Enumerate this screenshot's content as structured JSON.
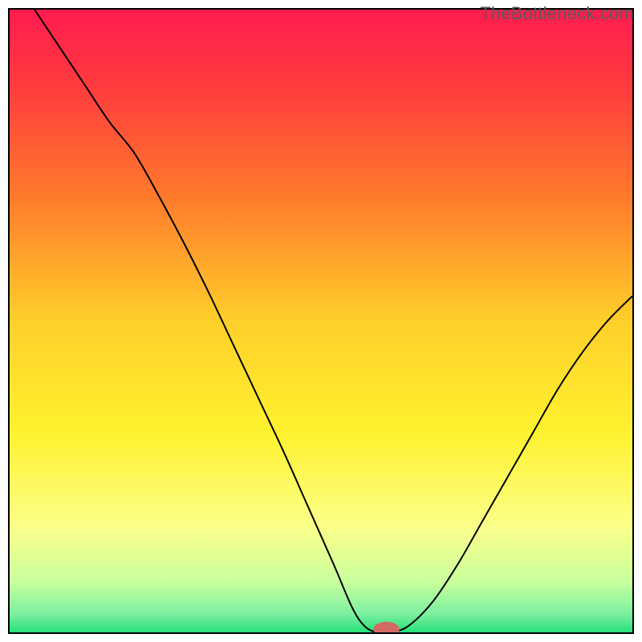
{
  "watermark": "TheBottleneck.com",
  "chart_data": {
    "type": "line",
    "title": "",
    "xlabel": "",
    "ylabel": "",
    "xlim": [
      0,
      100
    ],
    "ylim": [
      0,
      100
    ],
    "grid": false,
    "legend": false,
    "gradient_stops": [
      {
        "offset": 0.0,
        "color": "#ff1c4f"
      },
      {
        "offset": 0.12,
        "color": "#ff3a3f"
      },
      {
        "offset": 0.3,
        "color": "#ff7a2c"
      },
      {
        "offset": 0.5,
        "color": "#ffcf2a"
      },
      {
        "offset": 0.68,
        "color": "#fff22f"
      },
      {
        "offset": 0.83,
        "color": "#fbff89"
      },
      {
        "offset": 0.92,
        "color": "#c8ff9d"
      },
      {
        "offset": 0.97,
        "color": "#7cf0a0"
      },
      {
        "offset": 1.0,
        "color": "#26e07a"
      }
    ],
    "series": [
      {
        "name": "bottleneck-curve",
        "color": "#000000",
        "x": [
          4,
          8,
          12,
          16,
          20,
          24,
          28,
          32,
          36,
          40,
          44,
          48,
          52,
          55,
          57,
          59,
          61,
          64,
          68,
          72,
          76,
          80,
          84,
          88,
          92,
          96,
          100
        ],
        "y": [
          100,
          94,
          88,
          82,
          77,
          70,
          62.5,
          54.5,
          46,
          37.5,
          29,
          20,
          11,
          4,
          1,
          0,
          0,
          1,
          5,
          11,
          18,
          25,
          32,
          39,
          45,
          50,
          54
        ]
      }
    ],
    "marker": {
      "x": 60.5,
      "y": 0.5,
      "color": "#d46a63",
      "rx": 2.1,
      "ry": 1.2
    }
  }
}
